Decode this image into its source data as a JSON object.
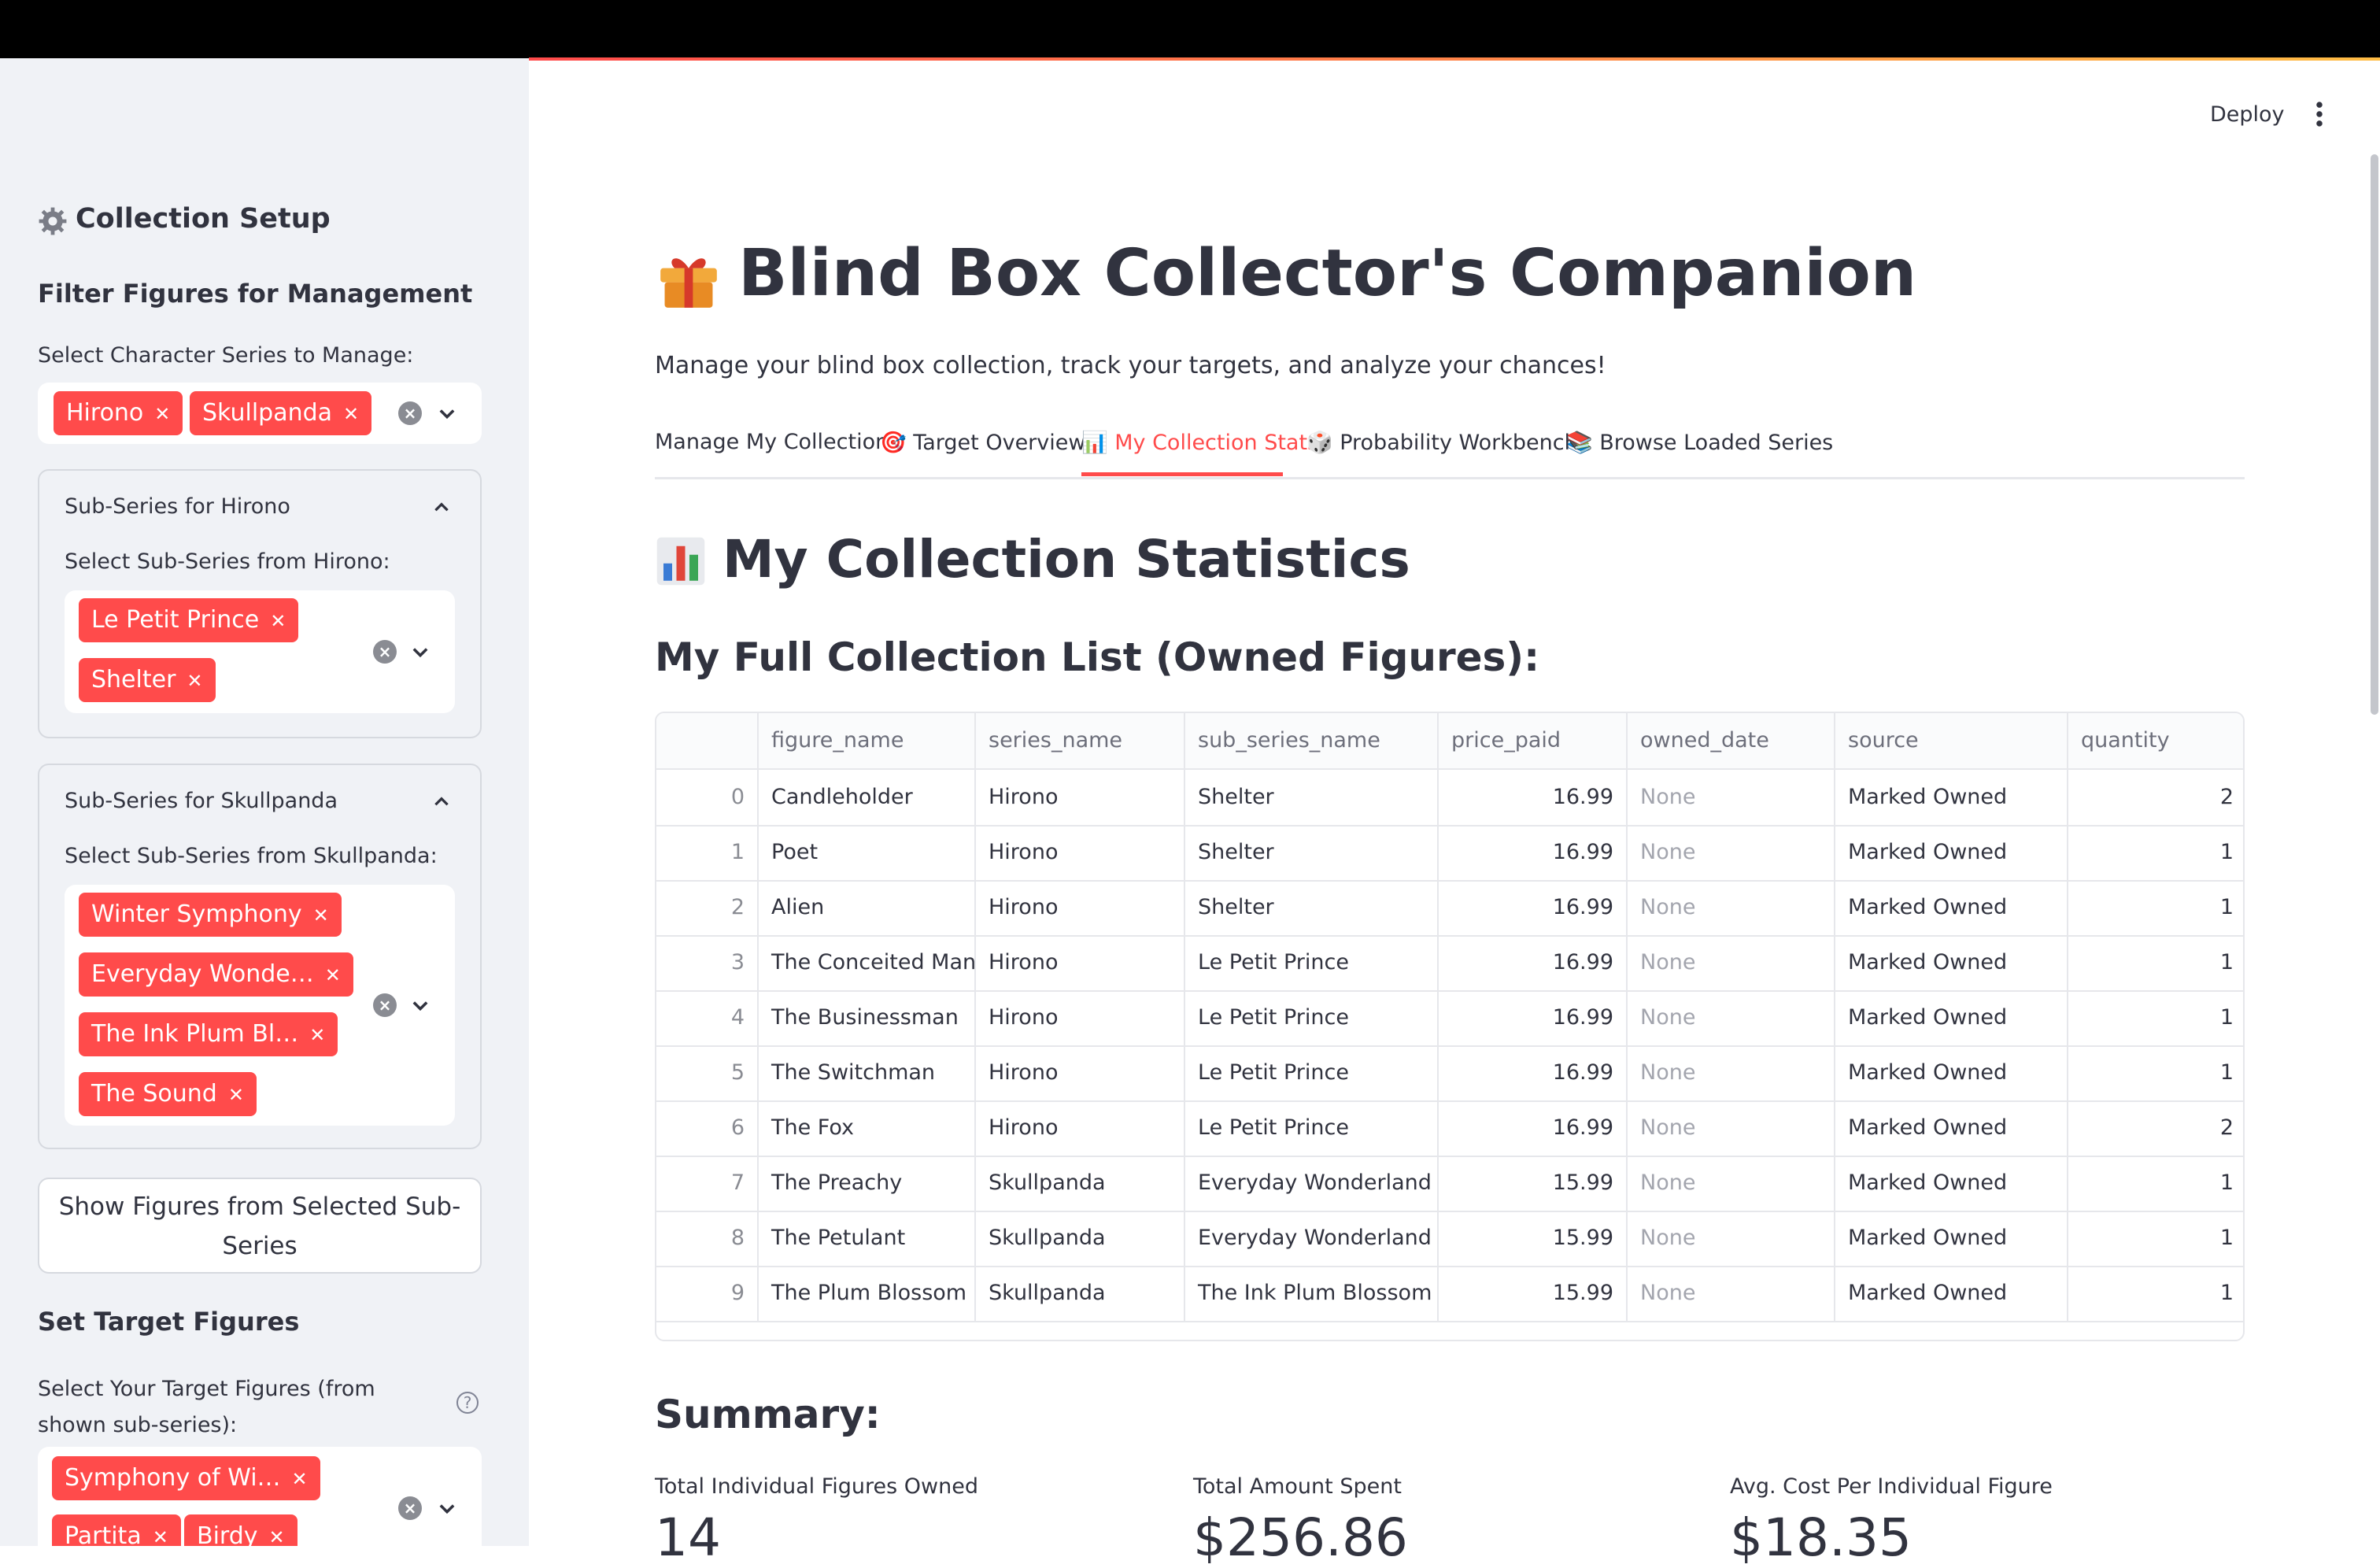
{
  "header": {
    "deploy_label": "Deploy"
  },
  "sidebar": {
    "setup_title": "Collection Setup",
    "filter_title": "Filter Figures for Management",
    "series_label": "Select Character Series to Manage:",
    "series_selected": [
      "Hirono",
      "Skullpanda"
    ],
    "hirono": {
      "title": "Sub-Series for Hirono",
      "label": "Select Sub-Series from Hirono:",
      "selected": [
        "Le Petit Prince",
        "Shelter"
      ]
    },
    "skullpanda": {
      "title": "Sub-Series for Skullpanda",
      "label": "Select Sub-Series from Skullpanda:",
      "selected": [
        "Winter Symphony",
        "Everyday Wonde…",
        "The Ink Plum Bl…",
        "The Sound"
      ]
    },
    "show_button": "Show Figures from Selected Sub-Series",
    "target_title": "Set Target Figures",
    "target_label": "Select Your Target Figures (from shown sub-series):",
    "target_selected": [
      "Symphony of Wi…",
      "Partita",
      "Birdy"
    ]
  },
  "main": {
    "title": "Blind Box Collector's Companion",
    "subtitle": "Manage your blind box collection, track your targets, and analyze your chances!",
    "tabs": [
      {
        "label": "Manage My Collection",
        "icon": ""
      },
      {
        "label": "Target Overview",
        "icon": "🎯"
      },
      {
        "label": "My Collection Stats",
        "icon": "📊"
      },
      {
        "label": "Probability Workbench",
        "icon": "🎲"
      },
      {
        "label": "Browse Loaded Series",
        "icon": "📚"
      }
    ],
    "stats_heading": "My Collection Statistics",
    "list_heading": "My Full Collection List (Owned Figures):",
    "summary_heading": "Summary:",
    "table": {
      "columns": [
        "",
        "figure_name",
        "series_name",
        "sub_series_name",
        "price_paid",
        "owned_date",
        "source",
        "quantity"
      ],
      "rows": [
        [
          "0",
          "Candleholder",
          "Hirono",
          "Shelter",
          "16.99",
          "None",
          "Marked Owned",
          "2"
        ],
        [
          "1",
          "Poet",
          "Hirono",
          "Shelter",
          "16.99",
          "None",
          "Marked Owned",
          "1"
        ],
        [
          "2",
          "Alien",
          "Hirono",
          "Shelter",
          "16.99",
          "None",
          "Marked Owned",
          "1"
        ],
        [
          "3",
          "The Conceited Man",
          "Hirono",
          "Le Petit Prince",
          "16.99",
          "None",
          "Marked Owned",
          "1"
        ],
        [
          "4",
          "The Businessman",
          "Hirono",
          "Le Petit Prince",
          "16.99",
          "None",
          "Marked Owned",
          "1"
        ],
        [
          "5",
          "The Switchman",
          "Hirono",
          "Le Petit Prince",
          "16.99",
          "None",
          "Marked Owned",
          "1"
        ],
        [
          "6",
          "The Fox",
          "Hirono",
          "Le Petit Prince",
          "16.99",
          "None",
          "Marked Owned",
          "2"
        ],
        [
          "7",
          "The Preachy",
          "Skullpanda",
          "Everyday Wonderland",
          "15.99",
          "None",
          "Marked Owned",
          "1"
        ],
        [
          "8",
          "The Petulant",
          "Skullpanda",
          "Everyday Wonderland",
          "15.99",
          "None",
          "Marked Owned",
          "1"
        ],
        [
          "9",
          "The Plum Blossom",
          "Skullpanda",
          "The Ink Plum Blossom",
          "15.99",
          "None",
          "Marked Owned",
          "1"
        ]
      ]
    },
    "metrics": [
      {
        "label": "Total Individual Figures Owned",
        "value": "14"
      },
      {
        "label": "Total Amount Spent",
        "value": "$256.86"
      },
      {
        "label": "Avg. Cost Per Individual Figure",
        "value": "$18.35"
      }
    ]
  },
  "colors": {
    "accent": "#FF4B4B",
    "sidebar_bg": "#F0F2F6",
    "text": "#31333F"
  }
}
